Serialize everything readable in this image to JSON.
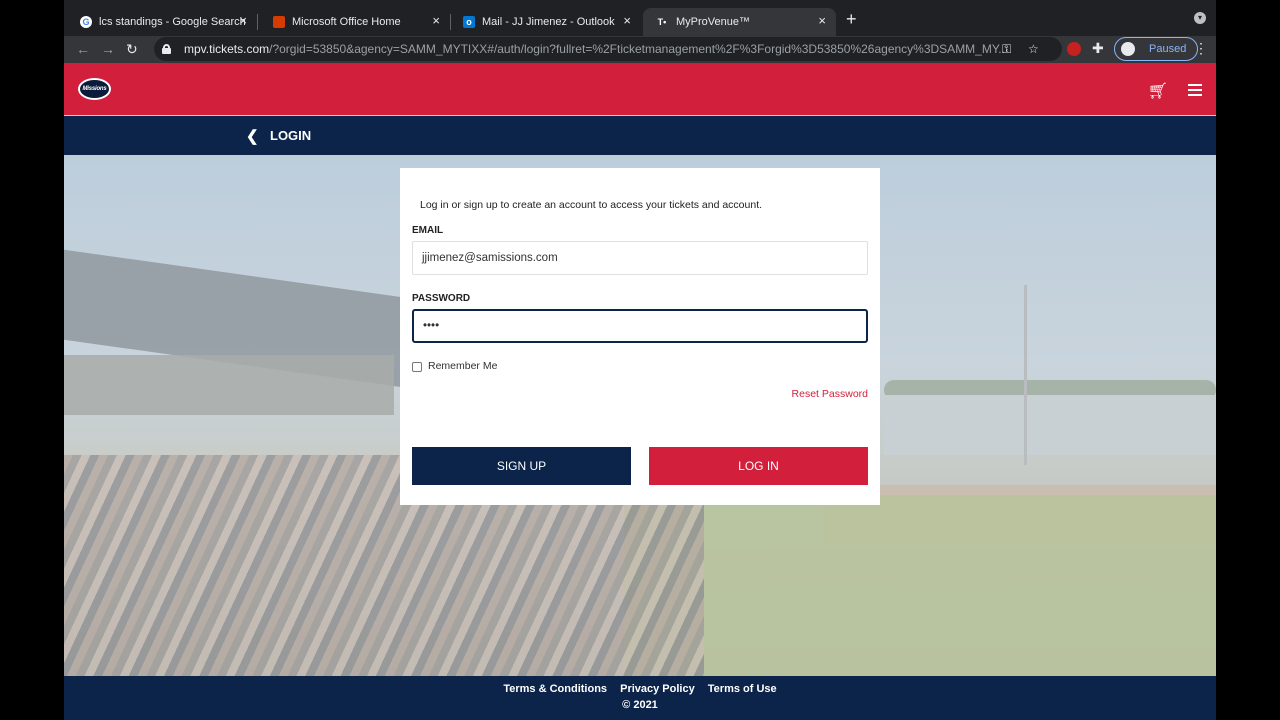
{
  "browser": {
    "tabs": [
      {
        "title": "lcs standings - Google Search",
        "favicon": "google-icon",
        "active": false
      },
      {
        "title": "Microsoft Office Home",
        "favicon": "office-icon",
        "active": false
      },
      {
        "title": "Mail - JJ Jimenez - Outlook",
        "favicon": "outlook-icon",
        "active": false
      },
      {
        "title": "MyProVenue™",
        "favicon": "myprovenue-icon",
        "active": true
      }
    ],
    "url_host": "mpv.tickets.com",
    "url_rest": "/?orgid=53850&agency=SAMM_MYTIXX#/auth/login?fullret=%2Fticketmanagement%2F%3Forgid%3D53850%26agency%3DSAMM_MY...",
    "profile_status": "Paused"
  },
  "site": {
    "logo_text": "Missions",
    "section_title": "LOGIN",
    "accent_red": "#d21f3c",
    "accent_navy": "#0c2449"
  },
  "login": {
    "intro": "Log in or sign up to create an account to access your tickets and account.",
    "email_label": "EMAIL",
    "email_value": "jjimenez@samissions.com",
    "password_label": "PASSWORD",
    "password_value": "••••",
    "remember_label": "Remember Me",
    "reset_link": "Reset Password",
    "signup_button": "SIGN UP",
    "login_button": "LOG IN"
  },
  "footer": {
    "links": [
      "Terms & Conditions",
      "Privacy Policy",
      "Terms of Use"
    ],
    "copyright": "© 2021"
  }
}
